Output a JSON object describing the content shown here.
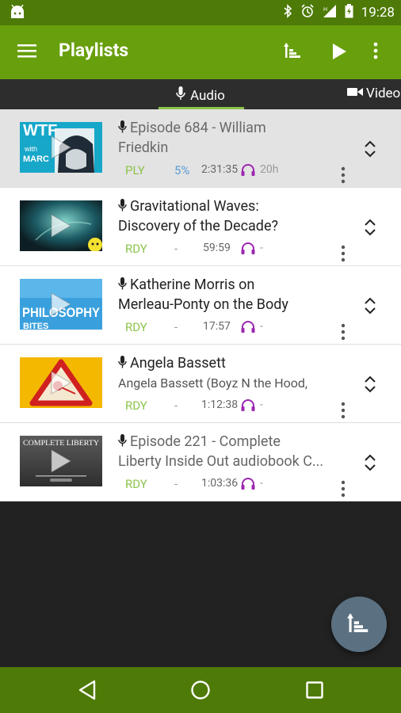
{
  "status_bar": {
    "time": "19:28"
  },
  "app_bar": {
    "title": "Playlists"
  },
  "tabs": {
    "audio": "Audio",
    "video": "Video"
  },
  "episodes": [
    {
      "line1": "Episode 684 - William",
      "line2": "Friedkin",
      "status": "PLY",
      "progress": "5%",
      "duration": "2:31:35",
      "remaining": "20h"
    },
    {
      "line1": "Gravitational Waves:",
      "line2": "Discovery of the Decade?",
      "status": "RDY",
      "progress": "-",
      "duration": "59:59",
      "remaining": "-"
    },
    {
      "line1": "Katherine Morris on",
      "line2": "Merleau-Ponty on the Body",
      "status": "RDY",
      "progress": "-",
      "duration": "17:57",
      "remaining": "-"
    },
    {
      "line1": "Angela Bassett",
      "line2": "Angela Bassett (Boyz N the Hood,",
      "status": "RDY",
      "progress": "-",
      "duration": "1:12:38",
      "remaining": "-"
    },
    {
      "line1": "Episode 221 - Complete",
      "line2": "Liberty Inside Out audiobook C...",
      "status": "RDY",
      "progress": "-",
      "duration": "1:03:36",
      "remaining": "-"
    }
  ],
  "thumbnails": {
    "wtf": "WTF",
    "wtf_with": "with",
    "wtf_marc": "MARC",
    "philosophy": "PHILOSOPHY",
    "philosophy_sub": "BITES",
    "liberty": "COMPLETE LIBERTY"
  },
  "colors": {
    "status_bar": "#4e7a07",
    "app_bar": "#689f0d",
    "tab_bar": "#2d2d2d",
    "tab_indicator": "#8bc34a",
    "status_text": "#8bc34a",
    "progress_text": "#5a9bd5",
    "headphones": "#9c27b0",
    "fab": "#5b7080",
    "nav_bar": "#4e7a07"
  }
}
